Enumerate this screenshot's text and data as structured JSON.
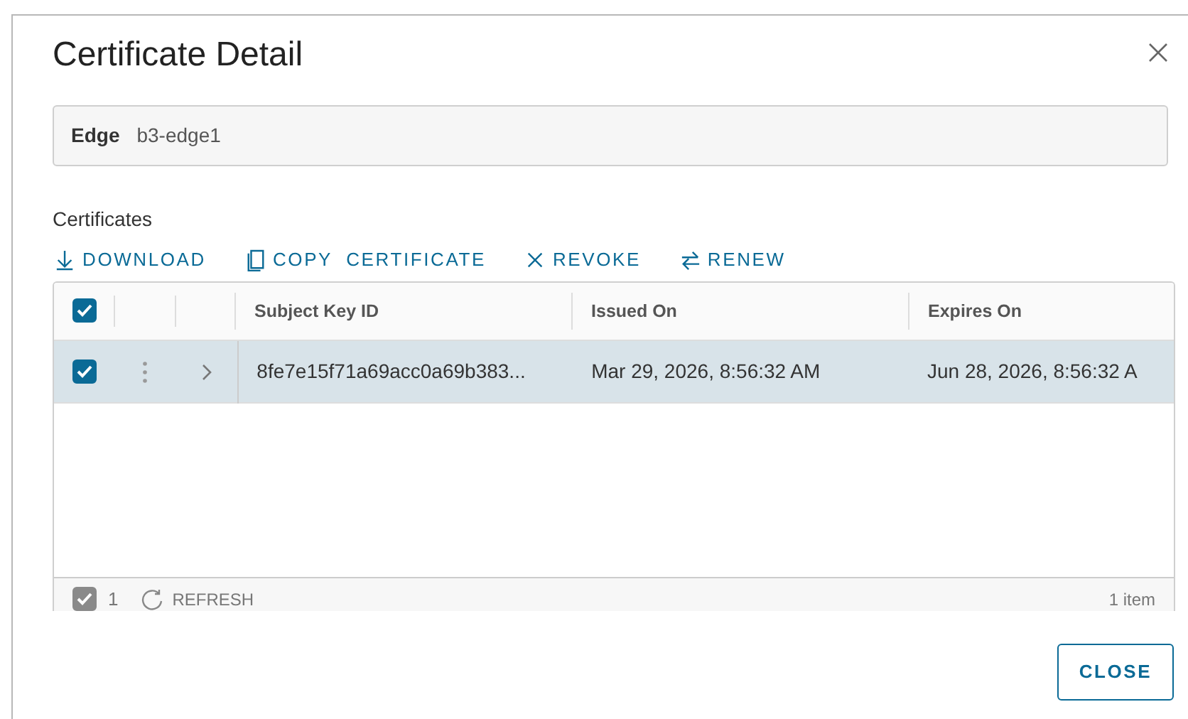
{
  "dialog": {
    "title": "Certificate Detail"
  },
  "edge": {
    "label": "Edge",
    "value": "b3-edge1"
  },
  "section_title": "Certificates",
  "actions": [
    {
      "kind": "download",
      "label": "DOWNLOAD"
    },
    {
      "kind": "copy",
      "label": "COPY  CERTIFICATE"
    },
    {
      "kind": "revoke",
      "label": "REVOKE"
    },
    {
      "kind": "renew",
      "label": "RENEW"
    }
  ],
  "table": {
    "select_all_checked": true,
    "columns": [
      "Subject Key ID",
      "Issued On",
      "Expires On"
    ],
    "rows": [
      {
        "selected": true,
        "cells": [
          "8fe7e15f71a69acc0a69b383...",
          "Mar 29, 2026, 8:56:32 AM",
          "Jun 28, 2026, 8:56:32 A"
        ]
      }
    ],
    "footer": {
      "checked": true,
      "selected_count": "1",
      "refresh": "REFRESH",
      "total": "1 item"
    }
  },
  "buttons": [
    "CLOSE"
  ]
}
